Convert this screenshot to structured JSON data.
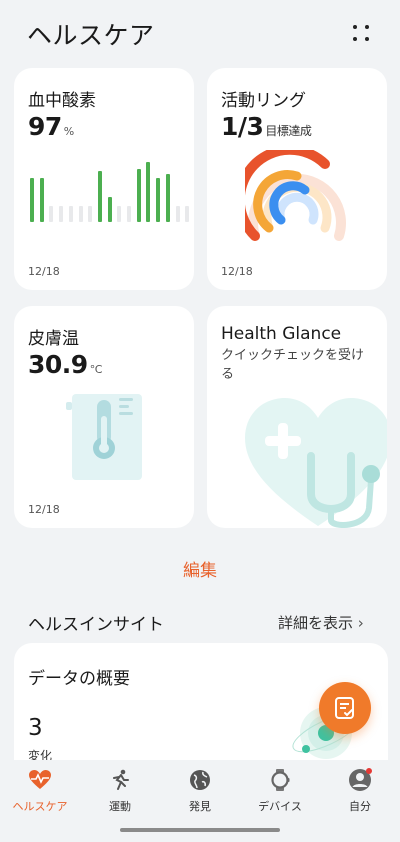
{
  "header": {
    "title": "ヘルスケア",
    "menu_icon": "more-grid-icon"
  },
  "cards": {
    "spo2": {
      "title": "血中酸素",
      "value": "97",
      "unit": "%",
      "date": "12/18",
      "bars": [
        0.95,
        0.95,
        0,
        0,
        0,
        0,
        0,
        1.1,
        0.55,
        0,
        0,
        1.15,
        1.3,
        0.95,
        1.05,
        0,
        0
      ]
    },
    "rings": {
      "title": "活動リング",
      "value": "1/3",
      "unit": "目標達成",
      "date": "12/18",
      "colors": {
        "outer": "#e8532c",
        "middle": "#f4a637",
        "inner": "#3b8ff0"
      }
    },
    "skin_temp": {
      "title": "皮膚温",
      "value": "30.9",
      "unit": "°C",
      "date": "12/18"
    },
    "glance": {
      "title": "Health Glance",
      "subtitle": "クイックチェックを受ける"
    }
  },
  "edit_label": "編集",
  "insights": {
    "title": "ヘルスインサイト",
    "link": "詳細を表示 ",
    "overview": {
      "title": "データの概要",
      "count": "3",
      "sub": "変化"
    }
  },
  "tabs": [
    {
      "label": "ヘルスケア",
      "icon": "heart-pulse-icon",
      "active": true
    },
    {
      "label": "運動",
      "icon": "running-icon",
      "active": false
    },
    {
      "label": "発見",
      "icon": "globe-icon",
      "active": false
    },
    {
      "label": "デバイス",
      "icon": "watch-icon",
      "active": false
    },
    {
      "label": "自分",
      "icon": "person-icon",
      "active": false
    }
  ],
  "colors": {
    "accent": "#e8622c",
    "green": "#4caf50"
  }
}
